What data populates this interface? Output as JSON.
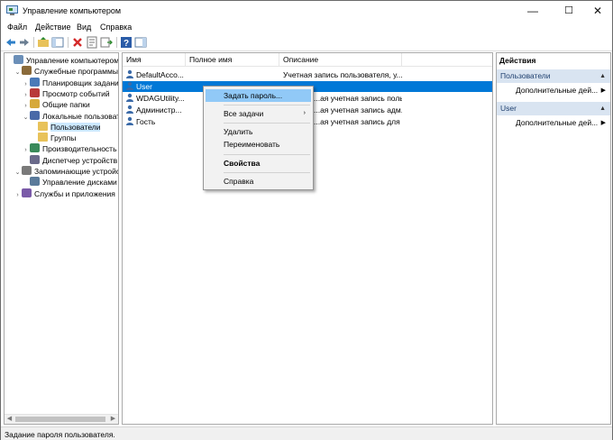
{
  "window": {
    "title": "Управление компьютером",
    "minimize": "—",
    "maximize": "☐",
    "close": "✕"
  },
  "menu": [
    "Файл",
    "Действие",
    "Вид",
    "Справка"
  ],
  "tree": [
    {
      "label": "Управление компьютером (л",
      "level": 0,
      "expander": "",
      "icon": "computer-management-icon"
    },
    {
      "label": "Служебные программы",
      "level": 1,
      "expander": "⌄",
      "icon": "tools-icon"
    },
    {
      "label": "Планировщик заданий",
      "level": 2,
      "expander": "›",
      "icon": "task-scheduler-icon"
    },
    {
      "label": "Просмотр событий",
      "level": 2,
      "expander": "›",
      "icon": "event-viewer-icon"
    },
    {
      "label": "Общие папки",
      "level": 2,
      "expander": "›",
      "icon": "shared-folders-icon"
    },
    {
      "label": "Локальные пользовате",
      "level": 2,
      "expander": "⌄",
      "icon": "local-users-icon"
    },
    {
      "label": "Пользователи",
      "level": 3,
      "expander": "",
      "icon": "folder-icon",
      "selected": true
    },
    {
      "label": "Группы",
      "level": 3,
      "expander": "",
      "icon": "folder-icon"
    },
    {
      "label": "Производительность",
      "level": 2,
      "expander": "›",
      "icon": "performance-icon"
    },
    {
      "label": "Диспетчер устройств",
      "level": 2,
      "expander": "",
      "icon": "device-manager-icon"
    },
    {
      "label": "Запоминающие устройст",
      "level": 1,
      "expander": "⌄",
      "icon": "storage-icon"
    },
    {
      "label": "Управление дисками",
      "level": 2,
      "expander": "",
      "icon": "disk-management-icon"
    },
    {
      "label": "Службы и приложения",
      "level": 1,
      "expander": "›",
      "icon": "services-icon"
    }
  ],
  "list": {
    "columns": [
      "Имя",
      "Полное имя",
      "Описание"
    ],
    "rows": [
      {
        "name": "DefaultAcco...",
        "full_name": "",
        "description": "Учетная запись пользователя, у..."
      },
      {
        "name": "User",
        "full_name": "",
        "description": "",
        "selected": true
      },
      {
        "name": "WDAGUtility...",
        "full_name": "",
        "description": "...ая учетная запись пользоват..."
      },
      {
        "name": "Администр...",
        "full_name": "",
        "description": "...ая учетная запись адм..."
      },
      {
        "name": "Гость",
        "full_name": "",
        "description": "...ая учетная запись для ..."
      }
    ]
  },
  "row_desc_visible": [
    "Учетная запись пользователя, у...",
    "",
    "я учетная запись пользователя, к...",
    "я учетная запись администрато...",
    "я учетная запись для гостевого..."
  ],
  "context_menu": {
    "items": [
      {
        "label": "Задать пароль...",
        "highlighted": true
      },
      {
        "label": "Все задачи",
        "submenu": true
      },
      {
        "label": "Удалить"
      },
      {
        "label": "Переименовать"
      },
      {
        "label": "Свойства",
        "bold": true
      },
      {
        "label": "Справка"
      }
    ]
  },
  "actions": {
    "header": "Действия",
    "sections": [
      {
        "title": "Пользователи",
        "item": "Дополнительные дей..."
      },
      {
        "title": "User",
        "item": "Дополнительные дей..."
      }
    ]
  },
  "status": "Задание пароля пользователя.",
  "colors": {
    "selection": "#0078d7",
    "highlight": "#91c9f7",
    "section_bg": "#d9e4f1"
  }
}
